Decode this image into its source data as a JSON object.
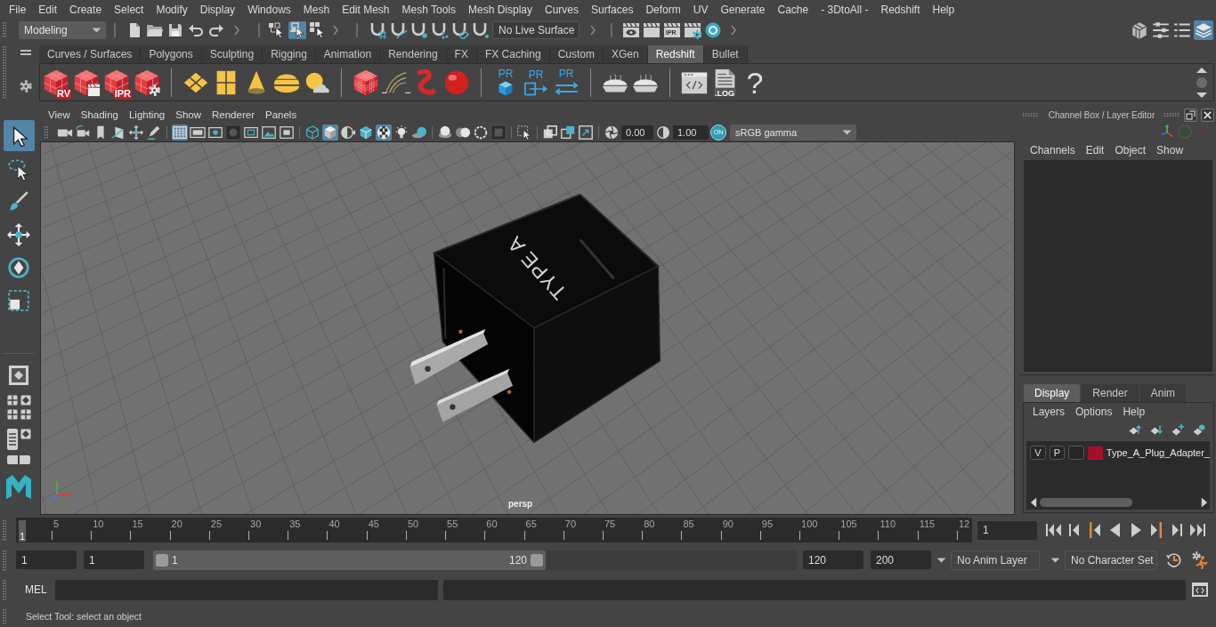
{
  "menu_bar": [
    "File",
    "Edit",
    "Create",
    "Select",
    "Modify",
    "Display",
    "Windows",
    "Mesh",
    "Edit Mesh",
    "Mesh Tools",
    "Mesh Display",
    "Curves",
    "Surfaces",
    "Deform",
    "UV",
    "Generate",
    "Cache",
    "- 3DtoAll -",
    "Redshift",
    "Help"
  ],
  "status_line": {
    "menu_set": "Modeling",
    "selection_modes": [
      {
        "selected": false
      },
      {
        "selected": true
      },
      {
        "selected": false
      }
    ],
    "live_surface": "No Live Surface",
    "render_buttons": [
      {
        "kind": "view"
      },
      {
        "kind": "still"
      },
      {
        "kind": "ipr",
        "caption": "IPR"
      },
      {
        "kind": "settings"
      },
      {
        "kind": "shader"
      }
    ],
    "panel_toggles": [
      {
        "selected": false
      },
      {
        "selected": false
      },
      {
        "selected": false
      },
      {
        "selected": true
      }
    ]
  },
  "shelf": {
    "tabs": [
      {
        "label": "Curves / Surfaces",
        "selected": false
      },
      {
        "label": "Polygons",
        "selected": false
      },
      {
        "label": "Sculpting",
        "selected": false
      },
      {
        "label": "Rigging",
        "selected": false
      },
      {
        "label": "Animation",
        "selected": false
      },
      {
        "label": "Rendering",
        "selected": false
      },
      {
        "label": "FX",
        "selected": false
      },
      {
        "label": "FX Caching",
        "selected": false
      },
      {
        "label": "Custom",
        "selected": false
      },
      {
        "label": "XGen",
        "selected": false
      },
      {
        "label": "Redshift",
        "selected": true
      },
      {
        "label": "Bullet",
        "selected": false
      }
    ],
    "groups": [
      [
        {
          "kind": "cube",
          "caption": "RV"
        },
        {
          "kind": "cube-clapboard"
        },
        {
          "kind": "cube",
          "caption": "IPR"
        },
        {
          "kind": "cube-gear"
        }
      ],
      [
        {
          "kind": "diamonds"
        },
        {
          "kind": "panels"
        },
        {
          "kind": "cone"
        },
        {
          "kind": "dome"
        },
        {
          "kind": "sun-cloud"
        }
      ],
      [
        {
          "kind": "cube-grid"
        },
        {
          "kind": "strands"
        },
        {
          "kind": "worm"
        },
        {
          "kind": "sphere"
        }
      ],
      [
        {
          "kind": "box",
          "caption": "PR"
        },
        {
          "kind": "export",
          "caption": "PR"
        },
        {
          "kind": "swap",
          "caption": "PR"
        }
      ],
      [
        {
          "kind": "pie"
        },
        {
          "kind": "pie"
        }
      ],
      [
        {
          "kind": "code-window"
        },
        {
          "kind": "document",
          "caption": ".LOG"
        },
        {
          "kind": "glyph",
          "caption": "?"
        }
      ]
    ]
  },
  "toolbox": {
    "tools": [
      {
        "selected": true
      },
      {
        "selected": false
      },
      {
        "selected": false
      },
      {
        "selected": false
      },
      {
        "selected": false
      },
      {
        "selected": false
      }
    ]
  },
  "viewport": {
    "menu": [
      "View",
      "Shading",
      "Lighting",
      "Show",
      "Renderer",
      "Panels"
    ],
    "toolbar": [
      {
        "selected": false
      },
      {
        "selected": false
      },
      {
        "selected": false
      },
      {
        "selected": false
      },
      {
        "selected": false
      },
      {
        "selected": false
      },
      {
        "selected": true
      },
      {
        "selected": false
      },
      {
        "selected": false
      },
      {
        "selected": false
      },
      {
        "selected": false
      },
      {
        "selected": false
      },
      {
        "selected": false
      },
      {
        "selected": false
      },
      {
        "selected": true
      },
      {
        "selected": false
      },
      {
        "selected": false
      },
      {
        "selected": true
      },
      {
        "selected": false
      },
      {
        "selected": false
      },
      {
        "selected": false
      },
      {
        "selected": false
      },
      {
        "selected": false
      },
      {
        "selected": false
      },
      {
        "selected": false
      },
      {
        "selected": false
      },
      {
        "selected": false
      },
      {
        "selected": false
      },
      {
        "selected": false
      },
      {
        "selected": false
      }
    ],
    "exposure": "0.00",
    "gamma": "1.00",
    "color_management": {
      "label": "ON",
      "on": true
    },
    "view_transform": "sRGB gamma",
    "model_label": "TYPE A",
    "camera": "persp"
  },
  "channel_box": {
    "title": "Channel Box / Layer Editor",
    "menu": [
      "Channels",
      "Edit",
      "Object",
      "Show"
    ],
    "layer_tabs": [
      {
        "label": "Display",
        "selected": true
      },
      {
        "label": "Render",
        "selected": false
      },
      {
        "label": "Anim",
        "selected": false
      }
    ],
    "layer_menu": [
      "Layers",
      "Options",
      "Help"
    ],
    "layers": [
      {
        "visibility": "V",
        "playback": "P",
        "name": "Type_A_Plug_Adapter_",
        "color": "#a3102e"
      }
    ]
  },
  "time_slider": {
    "current_frame": "1",
    "level": 0,
    "labels": [
      "5",
      "10",
      "15",
      "20",
      "25",
      "30",
      "35",
      "40",
      "45",
      "50",
      "55",
      "60",
      "65",
      "70",
      "75",
      "80",
      "85",
      "90",
      "95",
      "100",
      "105",
      "110",
      "115",
      "12"
    ],
    "frame_field": "1"
  },
  "range_slider": {
    "start": "1",
    "playback_start": "1",
    "range_start": "1",
    "range_end": "120",
    "level": 0.61,
    "playback_end": "120",
    "end": "200",
    "anim_layer": "No Anim Layer",
    "character_set": "No Character Set"
  },
  "command_line": {
    "language": "MEL"
  },
  "help_line": "Select Tool: select an object"
}
